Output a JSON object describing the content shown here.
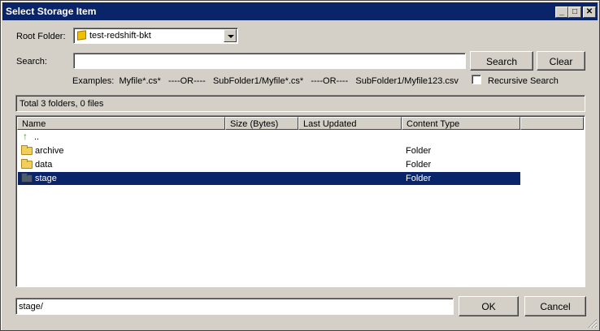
{
  "window": {
    "title": "Select Storage Item",
    "minimize": "_",
    "maximize": "□",
    "close": "✕"
  },
  "root_folder": {
    "label": "Root Folder:",
    "value": "test-redshift-bkt"
  },
  "search": {
    "label": "Search:",
    "value": "",
    "placeholder": "",
    "search_button": "Search",
    "clear_button": "Clear",
    "examples": "Examples:  Myfile*.cs*   ----OR----   SubFolder1/Myfile*.cs*   ----OR----   SubFolder1/Myfile123.csv",
    "recursive_label": "Recursive Search",
    "recursive_checked": false
  },
  "summary": "Total 3 folders, 0 files",
  "columns": [
    "Name",
    "Size (Bytes)",
    "Last Updated",
    "Content Type"
  ],
  "rows": [
    {
      "name": "..",
      "size": "",
      "updated": "",
      "type": ""
    },
    {
      "name": "archive",
      "size": "",
      "updated": "",
      "type": "Folder"
    },
    {
      "name": "data",
      "size": "",
      "updated": "",
      "type": "Folder"
    },
    {
      "name": "stage",
      "size": "",
      "updated": "",
      "type": "Folder",
      "selected": true
    }
  ],
  "footer": {
    "path_value": "stage/",
    "ok_button": "OK",
    "cancel_button": "Cancel"
  },
  "colors": {
    "titlebar": "#0a246a",
    "selection": "#0a246a",
    "face": "#d4d0c8"
  }
}
